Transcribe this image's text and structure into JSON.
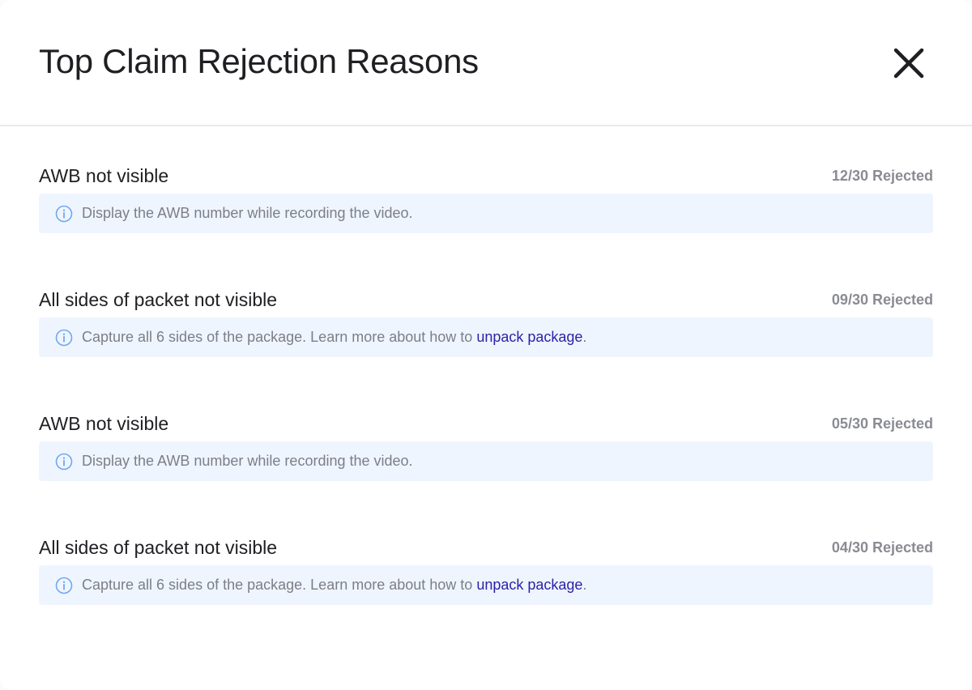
{
  "modal": {
    "title": "Top Claim Rejection Reasons",
    "close_icon": "close-icon"
  },
  "reasons": [
    {
      "title": "AWB not visible",
      "count": "12/30 Rejected",
      "tip": "Display the AWB number while recording the video.",
      "icon": "info-icon"
    },
    {
      "title": "All sides of packet not visible",
      "count": "09/30 Rejected",
      "tip": "Capture all 6 sides of the package. Learn more about how to ",
      "link": "unpack package",
      "tip_end": ".",
      "icon": "info-icon"
    },
    {
      "title": "AWB not visible",
      "count": "05/30 Rejected",
      "tip": "Display the AWB number while recording the video.",
      "icon": "info-icon"
    },
    {
      "title": "All sides of packet not visible",
      "count": "04/30 Rejected",
      "tip": "Capture all 6 sides of the package. Learn more about how to ",
      "link": "unpack package",
      "tip_end": ".",
      "icon": "info-icon"
    }
  ],
  "colors": {
    "info_icon": "#6ea8f0",
    "tip_background": "#eff5ff",
    "link": "#2e1fa6"
  }
}
